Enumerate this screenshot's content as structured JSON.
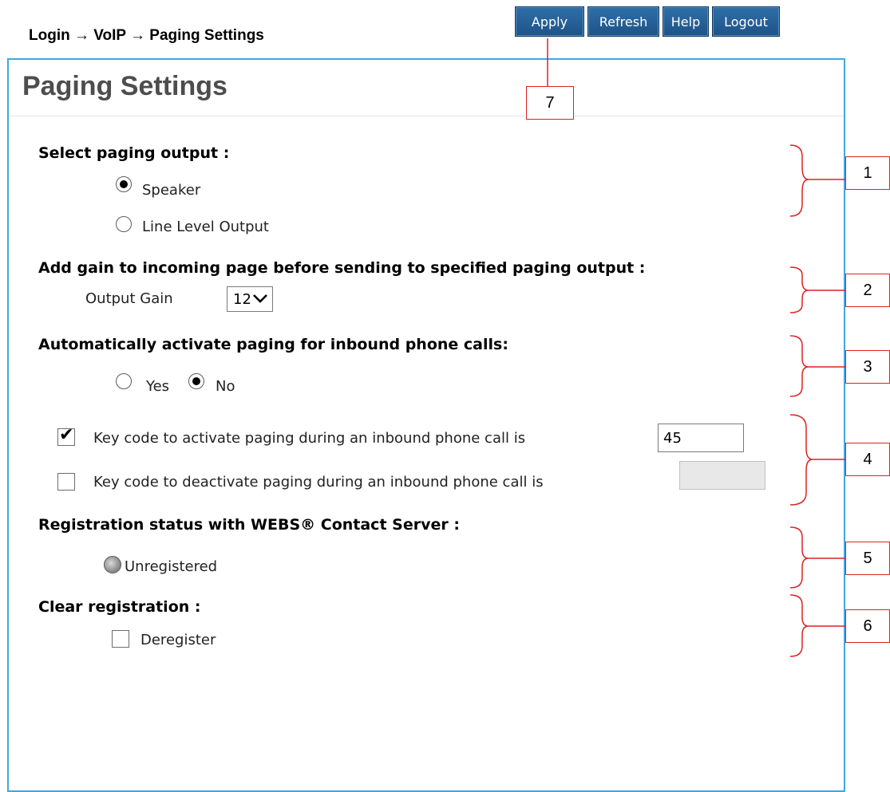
{
  "breadcrumb": "Login → VoIP → Paging Settings",
  "toolbar": {
    "apply": "Apply",
    "refresh": "Refresh",
    "help": "Help",
    "logout": "Logout"
  },
  "page_title": "Paging Settings",
  "paging_output": {
    "heading": "Select paging output :",
    "options": [
      {
        "label": "Speaker",
        "selected": true
      },
      {
        "label": "Line Level Output",
        "selected": false
      }
    ]
  },
  "gain": {
    "heading": "Add gain to incoming page before sending to specified paging output :",
    "label": "Output Gain",
    "value": "12"
  },
  "auto_activate": {
    "heading": "Automatically activate paging for inbound phone calls:",
    "yes_label": "Yes",
    "no_label": "No",
    "selected": "No"
  },
  "key_codes": {
    "activate_label": "Key code to activate paging during an inbound phone call is",
    "activate_checked": true,
    "activate_value": "45",
    "deactivate_label": "Key code to deactivate paging during an inbound phone call is",
    "deactivate_checked": false,
    "deactivate_value": ""
  },
  "registration": {
    "heading": "Registration status with WEBS® Contact Server :",
    "status": "Unregistered"
  },
  "clear_registration": {
    "heading": "Clear registration :",
    "label": "Deregister",
    "checked": false
  },
  "callouts": [
    "1",
    "2",
    "3",
    "4",
    "5",
    "6",
    "7"
  ],
  "colors": {
    "panel_border": "#41a8e0",
    "toolbar": "#1d5387",
    "callout": "#d22222"
  }
}
